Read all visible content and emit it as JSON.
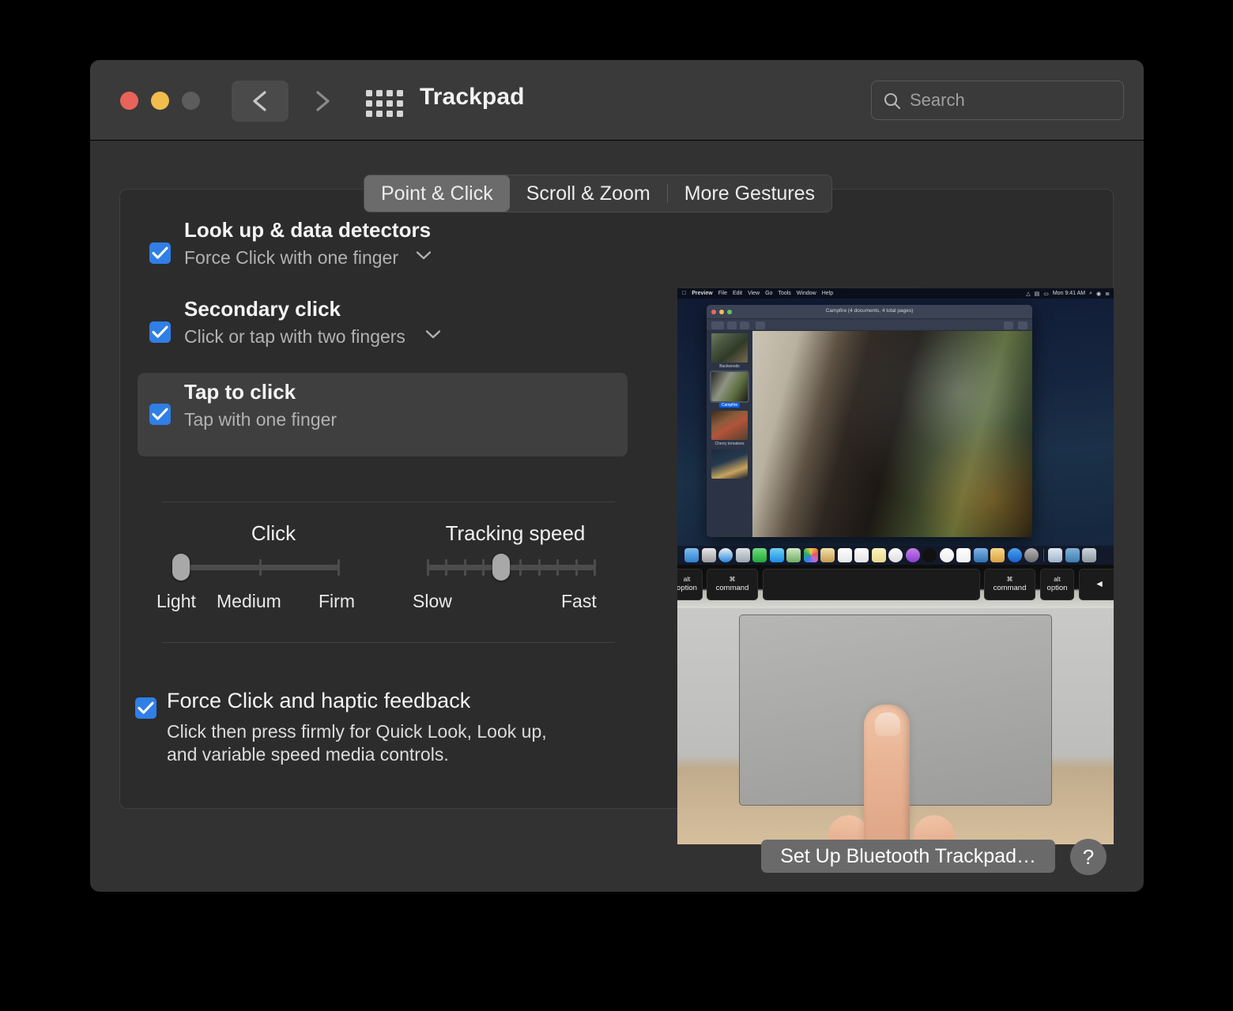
{
  "window": {
    "title": "Trackpad",
    "traffic_lights": [
      "close",
      "minimize",
      "zoom"
    ],
    "nav_back_icon": "chevron-left-icon",
    "nav_forward_icon": "chevron-right-icon",
    "grid_icon": "grid-view-icon",
    "colors": {
      "close": "#e8635a",
      "minimize": "#f2bd4c",
      "zoom": "#5c5c5c",
      "accent": "#307fe6",
      "window_bg": "#323232",
      "toolbar_bg": "#3a3a3a",
      "panel_bg": "#2c2c2c",
      "selected_row": "#3f3f3f"
    }
  },
  "search": {
    "placeholder": "Search",
    "value": "",
    "icon": "search-icon"
  },
  "tabs": [
    {
      "label": "Point & Click",
      "active": true
    },
    {
      "label": "Scroll & Zoom",
      "active": false
    },
    {
      "label": "More Gestures",
      "active": false
    }
  ],
  "options": [
    {
      "title": "Look up & data detectors",
      "subtitle": "Force Click with one finger",
      "checked": true,
      "has_dropdown": true,
      "selected": false
    },
    {
      "title": "Secondary click",
      "subtitle": "Click or tap with two fingers",
      "checked": true,
      "has_dropdown": true,
      "selected": false
    },
    {
      "title": "Tap to click",
      "subtitle": "Tap with one finger",
      "checked": true,
      "has_dropdown": false,
      "selected": true
    }
  ],
  "sliders": [
    {
      "label": "Click",
      "ticks": 3,
      "value_index": 0,
      "tick_labels": [
        "Light",
        "Medium",
        "Firm"
      ],
      "left_label": "Light",
      "right_label": "Firm"
    },
    {
      "label": "Tracking speed",
      "ticks": 10,
      "value_index": 4,
      "tick_labels": [],
      "left_label": "Slow",
      "right_label": "Fast"
    }
  ],
  "force_click": {
    "title": "Force Click and haptic feedback",
    "checked": true,
    "description_line1": "Click then press firmly for Quick Look, Look up,",
    "description_line2": "and variable speed media controls."
  },
  "footer": {
    "setup_button": "Set Up Bluetooth Trackpad…",
    "help_button": "?"
  },
  "preview": {
    "description": "MacBook showing Preview app with a campfire photo, dock, keyboard and a finger tapping the trackpad",
    "menubar": {
      "apple": "",
      "items": [
        "Preview",
        "File",
        "Edit",
        "View",
        "Go",
        "Tools",
        "Window",
        "Help"
      ],
      "clock": "Mon 9:41 AM",
      "status_icons": [
        "wifi-icon",
        "display-icon",
        "battery-icon",
        "search-icon",
        "siri-icon",
        "control-center-icon"
      ]
    },
    "app_window": {
      "title": "Campfire (4 documents, 4 total pages)",
      "thumbnails": [
        {
          "caption": "Backwoods",
          "selected": false
        },
        {
          "caption": "Campfire",
          "selected": true
        },
        {
          "caption": "Cherry tomatoes",
          "selected": false
        },
        {
          "caption": "",
          "selected": false
        }
      ]
    },
    "keyboard_keys": [
      {
        "top": "alt",
        "bottom": "option"
      },
      {
        "top": "⌘",
        "bottom": "command"
      },
      {
        "top": "",
        "bottom": ""
      },
      {
        "top": "⌘",
        "bottom": "command"
      },
      {
        "top": "alt",
        "bottom": "option"
      },
      {
        "top": "◀",
        "bottom": ""
      }
    ],
    "dock_icons": [
      "finder-icon",
      "launchpad-icon",
      "safari-icon",
      "contacts-icon",
      "facetime-icon",
      "messages-icon",
      "maps-icon",
      "photos-icon",
      "notes-icon",
      "calendar-icon",
      "reminders-icon",
      "stickies-icon",
      "music-icon",
      "podcasts-icon",
      "appletv-icon",
      "news-icon",
      "numbers-icon",
      "keynote-icon",
      "pages-icon",
      "appstore-icon",
      "system-preferences-icon",
      "preview-icon",
      "downloads-folder-icon",
      "trash-icon"
    ]
  }
}
